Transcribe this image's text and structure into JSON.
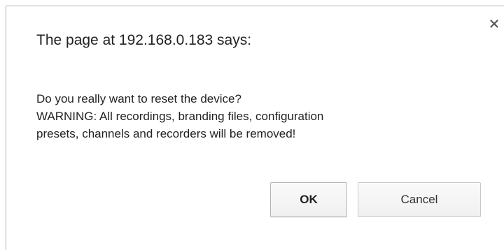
{
  "dialog": {
    "title": "The page at 192.168.0.183 says:",
    "message": {
      "line1": "Do you really want to reset the device?",
      "line2": "WARNING: All recordings, branding files, configuration",
      "line3": "presets, channels and recorders will be removed!"
    },
    "ok_label": "OK",
    "cancel_label": "Cancel",
    "close_icon": "close-icon"
  },
  "colors": {
    "text": "#222222",
    "border": "#b3b3b3",
    "button_border": "#c8c8c8",
    "close_icon": "#555555"
  }
}
